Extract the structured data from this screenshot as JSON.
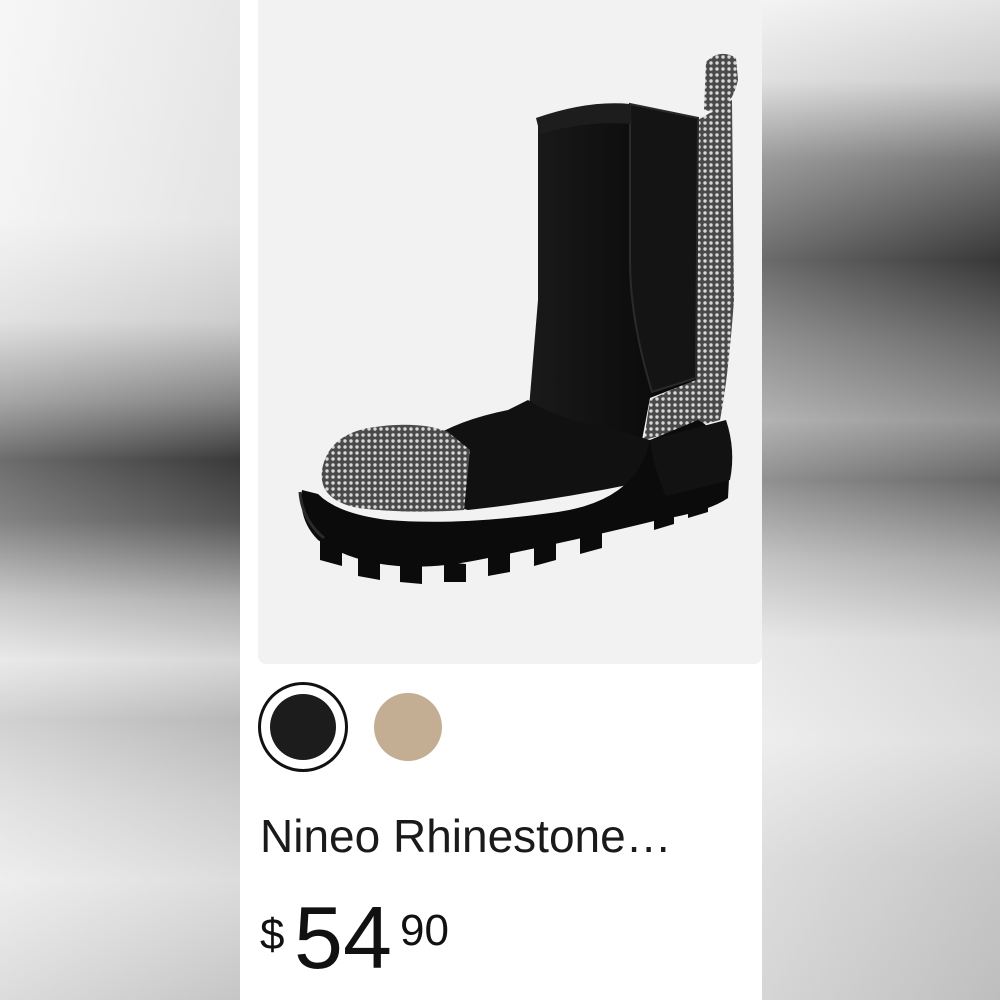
{
  "product": {
    "title": "Nineo Rhinestone…",
    "price": {
      "currency_symbol": "$",
      "whole": "54",
      "fraction": "90"
    },
    "image_icon": "chelsea-boot-image"
  },
  "swatches": [
    {
      "name": "black",
      "color": "#1c1c1c",
      "selected": true
    },
    {
      "name": "tan",
      "color": "#c4ae93",
      "selected": false
    }
  ]
}
